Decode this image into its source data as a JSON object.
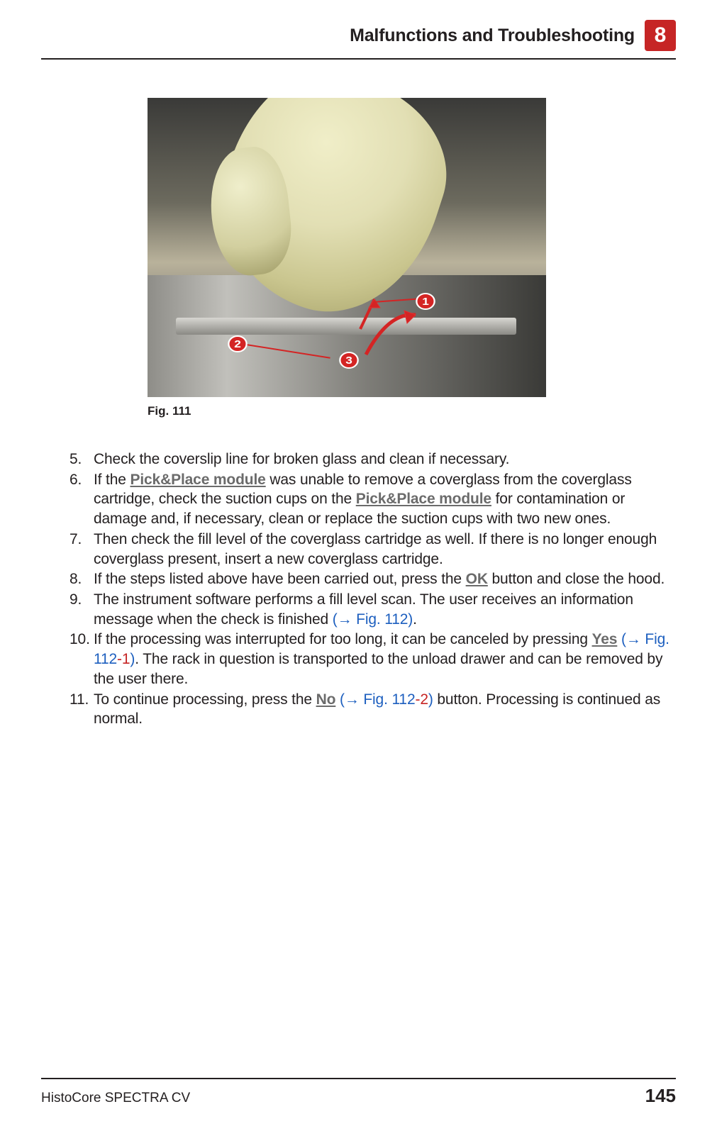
{
  "header": {
    "title": "Malfunctions and Troubleshooting",
    "chapter": "8"
  },
  "figure": {
    "caption": "Fig.  111",
    "callouts": [
      "1",
      "2",
      "3"
    ]
  },
  "steps": {
    "s5": "Check the coverslip line for broken glass and clean if necessary.",
    "s6_a": "If the ",
    "s6_link1": "Pick&Place module",
    "s6_b": " was unable to remove a coverglass from the coverglass cartridge, check the suction cups on the ",
    "s6_link2": "Pick&Place module",
    "s6_c": " for contamination or damage and, if necessary, clean or replace the suction cups with two new ones.",
    "s7": "Then check the fill level of the coverglass cartridge as well. If there is no longer enough coverglass present, insert a new coverglass cartridge.",
    "s8_a": "If the steps listed above have been carried out, press the ",
    "s8_ok": "OK",
    "s8_b": " button and close the hood.",
    "s9_a": "The instrument software performs a fill level scan. The user receives an information message when the check is finished ",
    "s9_ref": "(→ Fig.  112)",
    "s9_b": ".",
    "s10_a": "If the processing was interrupted for too long, it can be canceled by pressing ",
    "s10_yes": "Yes",
    "s10_b": " ",
    "s10_ref_open": "(→ Fig.  112",
    "s10_ref_dash": "-",
    "s10_ref_sub": "1",
    "s10_ref_close": ")",
    "s10_c": ". The rack in question is transported to the unload drawer and can be removed by the user there.",
    "s11_a": "To continue processing, press the ",
    "s11_no": "No",
    "s11_b": " ",
    "s11_ref_open": "(→ Fig.  112",
    "s11_ref_dash": "-",
    "s11_ref_sub": "2",
    "s11_ref_close": ")",
    "s11_c": " button. Processing is continued as normal."
  },
  "footer": {
    "doc": "HistoCore SPECTRA CV",
    "page": "145"
  }
}
